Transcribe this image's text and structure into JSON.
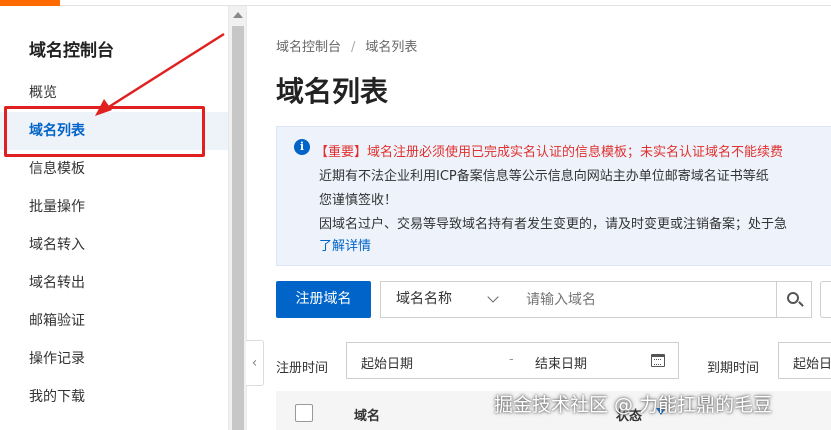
{
  "sidebar": {
    "title": "域名控制台",
    "items": [
      {
        "label": "概览"
      },
      {
        "label": "域名列表",
        "active": true
      },
      {
        "label": "信息模板"
      },
      {
        "label": "批量操作"
      },
      {
        "label": "域名转入"
      },
      {
        "label": "域名转出"
      },
      {
        "label": "邮箱验证"
      },
      {
        "label": "操作记录"
      },
      {
        "label": "我的下载"
      }
    ]
  },
  "main": {
    "breadcrumb": [
      "域名控制台",
      "域名列表"
    ],
    "breadcrumb_sep": "/",
    "page_title": "域名列表",
    "notice": {
      "icon": "info-icon",
      "lines": [
        "【重要】域名注册必须使用已完成实名认证的信息模板；未实名认证域名不能续费",
        "近期有不法企业利用ICP备案信息等公示信息向网站主办单位邮寄域名证书等纸",
        "您谨慎签收！",
        "因域名过户、交易等导致域名持有者发生变更的，请及时变更或注销备案；处于急"
      ],
      "link": "了解详情"
    },
    "toolbar": {
      "register_label": "注册域名",
      "search_field": "域名名称",
      "search_placeholder": "请输入域名"
    },
    "filters": {
      "reg_time_label": "注册时间",
      "start_date": "起始日期",
      "range_sep": "-",
      "end_date": "结束日期",
      "expire_label": "到期时间",
      "start_date2": "起始日"
    },
    "table": {
      "columns": [
        "域名",
        "状态"
      ]
    }
  },
  "watermark": "掘金技术社区 @ 力能扛鼎的毛豆",
  "colors": {
    "accent": "#0064c8",
    "annotation": "#e02020",
    "notice_red": "#e0312f",
    "brand": "#ff6a00"
  }
}
